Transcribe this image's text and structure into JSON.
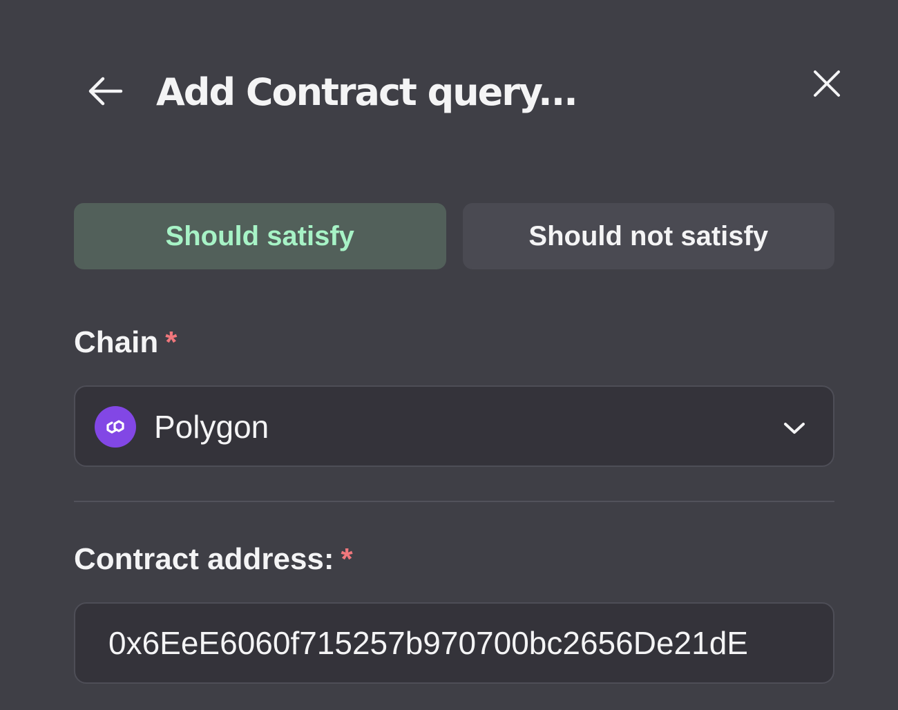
{
  "header": {
    "title": "Add Contract query...",
    "back_icon": "arrow-left-icon",
    "close_icon": "close-icon"
  },
  "toggle": {
    "options": [
      {
        "label": "Should satisfy",
        "selected": true
      },
      {
        "label": "Should not satisfy",
        "selected": false
      }
    ]
  },
  "chain": {
    "label": "Chain",
    "required_mark": "*",
    "selected_value": "Polygon",
    "logo_icon": "polygon-logo-icon",
    "dropdown_icon": "chevron-down-icon"
  },
  "contract": {
    "label": "Contract address:",
    "required_mark": "*",
    "value": "0x6EeE6060f715257b970700bc2656De21dE"
  },
  "colors": {
    "background": "#3f3f46",
    "active_toggle_bg": "#52605a",
    "active_toggle_text": "#a7f3c6",
    "required_mark": "#f0777c",
    "polygon_brand": "#8247e5"
  }
}
